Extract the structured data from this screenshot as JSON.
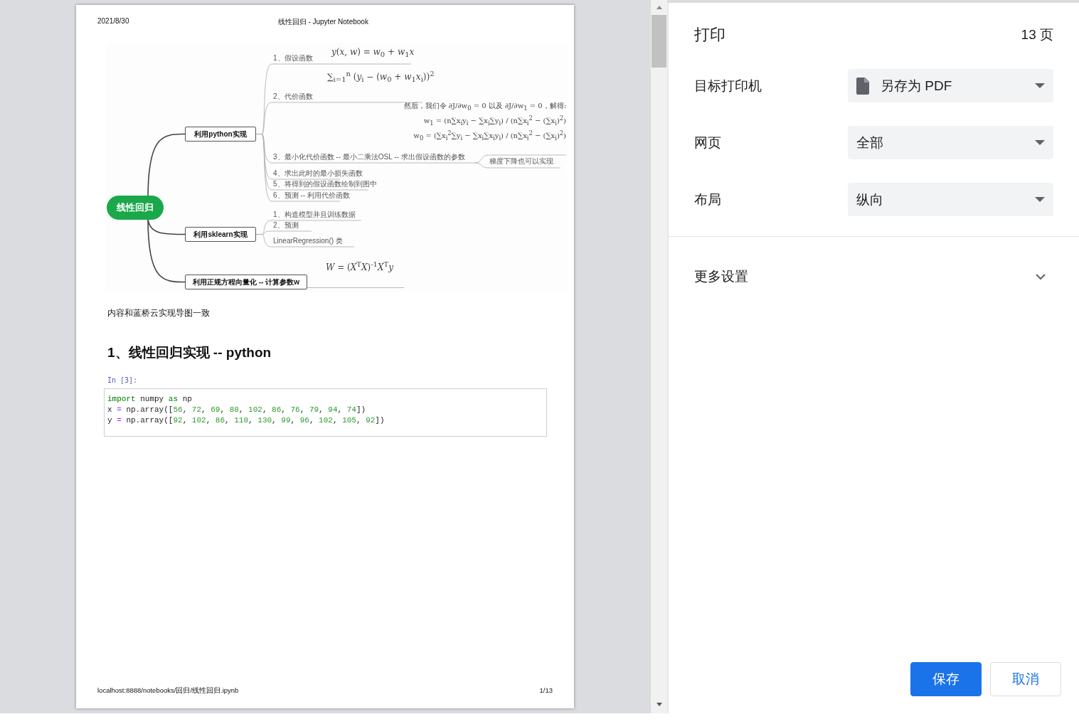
{
  "preview": {
    "header": {
      "date": "2021/8/30",
      "title": "线性回归 - Jupyter Notebook"
    },
    "mindmap": {
      "root": "线性回归",
      "branches": [
        {
          "label": "利用python实现",
          "children": [
            {
              "kind": "topic",
              "label": "1、假设函数",
              "formula": "*y*(*x*, *w*) = *w*$_{0}$ + *w*$_{1}$*x*"
            },
            {
              "kind": "topic",
              "label": "2、代价函数",
              "formula": "∑$_{i=1}$$^{n}$ (*y*$_{i}$ − (*w*$_{0}$ + *w*$_{1}$*x*$_{i}$))$^{2}$"
            },
            {
              "kind": "topic",
              "label": "3、最小化代价函数 -- 最小二乘法OSL -- 求出假设函数的参数",
              "children": [
                {
                  "kind": "formula",
                  "lines": [
                    "然后，我们令 ∂J/∂w$_{0}$ = 0 以及 ∂J/∂w$_{1}$ = 0，解得:",
                    "w$_{1}$ = (n∑x$_{i}$y$_{i}$ − ∑x$_{i}$∑y$_{i}$) / (n∑x$_{i}$$^{2}$ − (∑x$_{i}$)$^{2}$)",
                    "w$_{0}$ = (∑x$_{i}$$^{2}$∑y$_{i}$ − ∑x$_{i}$∑x$_{i}$y$_{i}$) / (n∑x$_{i}$$^{2}$ − (∑x$_{i}$)$^{2}$)"
                  ]
                },
                {
                  "kind": "topic",
                  "label": "梯度下降也可以实现"
                }
              ]
            },
            {
              "kind": "topic",
              "label": "4、求出此时的最小损失函数"
            },
            {
              "kind": "topic",
              "label": "5、将得到的假设函数绘制到图中"
            },
            {
              "kind": "topic",
              "label": "6、预测 -- 利用代价函数"
            }
          ]
        },
        {
          "label": "利用sklearn实现",
          "children": [
            {
              "kind": "topic",
              "label": "1、构造模型并且训练数据"
            },
            {
              "kind": "topic",
              "label": "2、预测"
            },
            {
              "kind": "topic",
              "label": "LinearRegression() 类"
            }
          ]
        },
        {
          "label": "利用正规方程向量化 -- 计算参数w",
          "children": [
            {
              "kind": "formula",
              "lines": [
                "*W* = (*X*$^{T}$*X*)$^{-1}$*X*$^{T}$*y*"
              ]
            }
          ]
        }
      ]
    },
    "note": "内容和蓝桥云实现导图一致",
    "heading": "1、线性回归实现 -- python",
    "cell": {
      "prompt": "In  [3]:",
      "lines": [
        [
          {
            "t": "import",
            "kind": "kw"
          },
          {
            "t": " numpy ",
            "kind": "text"
          },
          {
            "t": "as",
            "kind": "kw"
          },
          {
            "t": " np",
            "kind": "text"
          }
        ],
        [
          {
            "t": "x ",
            "kind": "text"
          },
          {
            "t": "=",
            "kind": "op"
          },
          {
            "t": " np.array([",
            "kind": "text"
          },
          {
            "t": "56",
            "kind": "num"
          },
          {
            "t": ", ",
            "kind": "text"
          },
          {
            "t": "72",
            "kind": "num"
          },
          {
            "t": ", ",
            "kind": "text"
          },
          {
            "t": "69",
            "kind": "num"
          },
          {
            "t": ", ",
            "kind": "text"
          },
          {
            "t": "88",
            "kind": "num"
          },
          {
            "t": ", ",
            "kind": "text"
          },
          {
            "t": "102",
            "kind": "num"
          },
          {
            "t": ", ",
            "kind": "text"
          },
          {
            "t": "86",
            "kind": "num"
          },
          {
            "t": ", ",
            "kind": "text"
          },
          {
            "t": "76",
            "kind": "num"
          },
          {
            "t": ", ",
            "kind": "text"
          },
          {
            "t": "79",
            "kind": "num"
          },
          {
            "t": ", ",
            "kind": "text"
          },
          {
            "t": "94",
            "kind": "num"
          },
          {
            "t": ", ",
            "kind": "text"
          },
          {
            "t": "74",
            "kind": "num"
          },
          {
            "t": "])",
            "kind": "text"
          }
        ],
        [
          {
            "t": "y ",
            "kind": "text"
          },
          {
            "t": "=",
            "kind": "op"
          },
          {
            "t": " np.array([",
            "kind": "text"
          },
          {
            "t": "92",
            "kind": "num"
          },
          {
            "t": ", ",
            "kind": "text"
          },
          {
            "t": "102",
            "kind": "num"
          },
          {
            "t": ", ",
            "kind": "text"
          },
          {
            "t": "86",
            "kind": "num"
          },
          {
            "t": ", ",
            "kind": "text"
          },
          {
            "t": "110",
            "kind": "num"
          },
          {
            "t": ", ",
            "kind": "text"
          },
          {
            "t": "130",
            "kind": "num"
          },
          {
            "t": ", ",
            "kind": "text"
          },
          {
            "t": "99",
            "kind": "num"
          },
          {
            "t": ", ",
            "kind": "text"
          },
          {
            "t": "96",
            "kind": "num"
          },
          {
            "t": ", ",
            "kind": "text"
          },
          {
            "t": "102",
            "kind": "num"
          },
          {
            "t": ", ",
            "kind": "text"
          },
          {
            "t": "105",
            "kind": "num"
          },
          {
            "t": ", ",
            "kind": "text"
          },
          {
            "t": "92",
            "kind": "num"
          },
          {
            "t": "])",
            "kind": "text"
          }
        ]
      ]
    },
    "footer": {
      "url": "localhost:8888/notebooks/回归/线性回归.ipynb",
      "page": "1/13"
    }
  },
  "panel": {
    "title": "打印",
    "pages": "13 页",
    "settings": [
      {
        "label": "目标打印机",
        "value": "另存为 PDF",
        "has_icon": true
      },
      {
        "label": "网页",
        "value": "全部",
        "has_icon": false
      },
      {
        "label": "布局",
        "value": "纵向",
        "has_icon": false
      }
    ],
    "more": {
      "label": "更多设置",
      "expanded": false
    },
    "buttons": [
      {
        "label": "保存",
        "primary": true
      },
      {
        "label": "取消",
        "primary": false
      }
    ]
  }
}
